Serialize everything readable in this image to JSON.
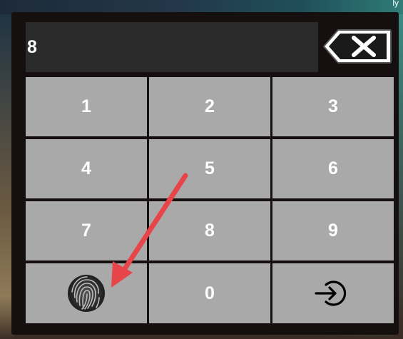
{
  "header": {
    "corner_text": "ly"
  },
  "pin_display": {
    "value": "8"
  },
  "backspace": {
    "icon": "backspace-icon"
  },
  "keypad": {
    "keys": [
      "1",
      "2",
      "3",
      "4",
      "5",
      "6",
      "7",
      "8",
      "9"
    ],
    "zero": "0",
    "fingerprint_icon": "fingerprint-icon",
    "login_icon": "login-icon"
  },
  "colors": {
    "key_background": "#a9a9a9",
    "panel_background": "#150f0f",
    "display_background": "#2b2b2b",
    "annotation_arrow": "#e8454a"
  }
}
